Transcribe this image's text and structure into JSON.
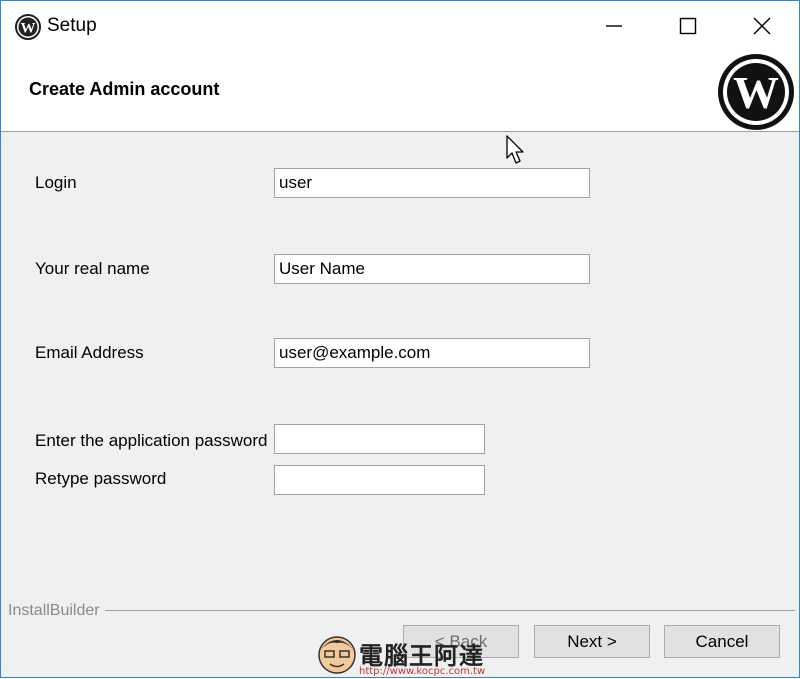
{
  "window": {
    "title": "Setup"
  },
  "header": {
    "title": "Create Admin account"
  },
  "form": {
    "login": {
      "label": "Login",
      "value": "user"
    },
    "real_name": {
      "label": "Your real name",
      "value": "User Name"
    },
    "email": {
      "label": "Email Address",
      "value": "user@example.com"
    },
    "password": {
      "label": "Enter the application password",
      "value": ""
    },
    "retype": {
      "label": "Retype password",
      "value": ""
    }
  },
  "footer": {
    "brand": "InstallBuilder",
    "back_label": "< Back",
    "next_label": "Next >",
    "cancel_label": "Cancel"
  },
  "watermark": {
    "text": "電腦王阿達",
    "url": "http://www.kocpc.com.tw"
  },
  "colors": {
    "border_accent": "#2b88d8",
    "dialog_bg": "#f0f0f0",
    "button_bg": "#e1e1e1"
  },
  "icons": [
    "wordpress-icon",
    "minimize-icon",
    "maximize-icon",
    "close-icon",
    "wordpress-logo",
    "mouse-cursor-icon"
  ]
}
